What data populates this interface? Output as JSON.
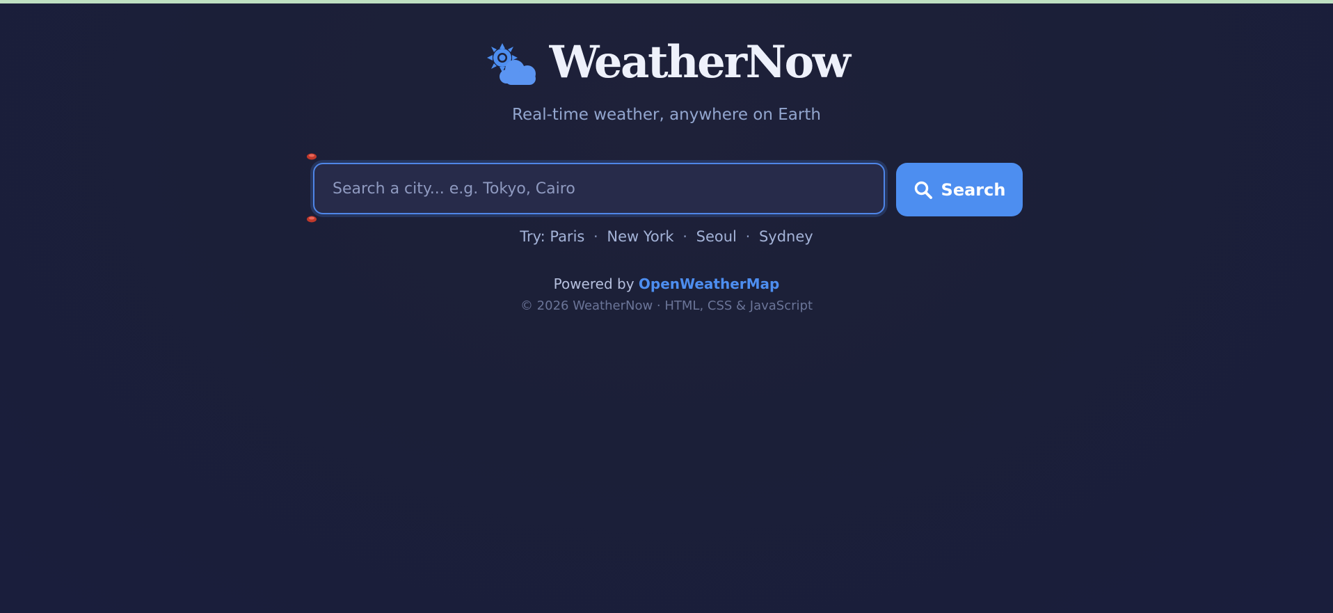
{
  "brand": {
    "title": "WeatherNow",
    "subtitle": "Real-time weather, anywhere on Earth",
    "logo_icon": "sun-cloud-icon"
  },
  "search": {
    "placeholder": "Search a city... e.g. Tokyo, Cairo",
    "value": "",
    "button_label": "Search",
    "button_icon": "search-icon"
  },
  "suggestions": {
    "prefix": "Try:",
    "cities": [
      "Paris",
      "New York",
      "Seoul",
      "Sydney"
    ],
    "separator": "·"
  },
  "footer": {
    "powered_prefix": "Powered by",
    "powered_link": "OpenWeatherMap",
    "copyright": "© 2026 WeatherNow · HTML, CSS & JavaScript"
  },
  "colors": {
    "background": "#1b1f38",
    "accent": "#4d8ef0",
    "title": "#eef1fb",
    "subtitle": "#93a6cf",
    "top_strip": "#bfe0c2"
  }
}
